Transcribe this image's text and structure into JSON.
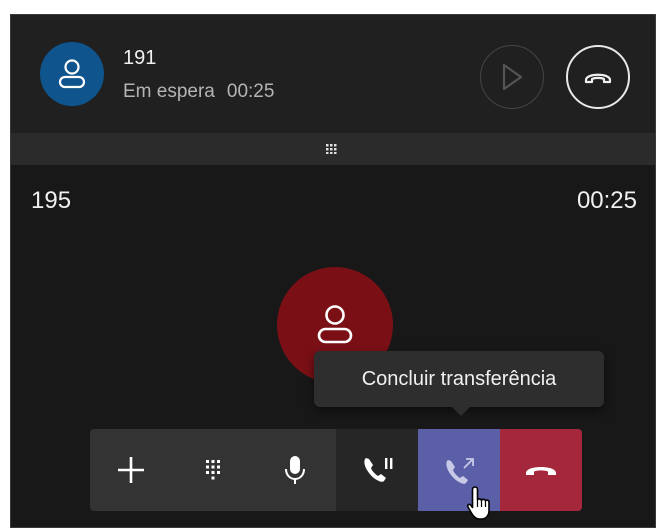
{
  "held_call": {
    "number": "191",
    "status": "Em espera",
    "timer": "00:25",
    "avatar_icon": "person-icon",
    "resume_icon": "play-icon",
    "hangup_icon": "hang-up-icon"
  },
  "divider": {
    "icon": "grip-dots-icon"
  },
  "active_call": {
    "number": "195",
    "timer": "00:25",
    "avatar_icon": "person-icon"
  },
  "tooltip": {
    "text": "Concluir transferência"
  },
  "controls": [
    {
      "name": "add",
      "icon": "plus-icon"
    },
    {
      "name": "dialpad",
      "icon": "dialpad-icon"
    },
    {
      "name": "mute",
      "icon": "microphone-icon"
    },
    {
      "name": "hold",
      "icon": "phone-hold-icon"
    },
    {
      "name": "transfer",
      "icon": "phone-transfer-icon"
    },
    {
      "name": "end",
      "icon": "hang-up-icon"
    }
  ],
  "colors": {
    "held_avatar": "#0f548c",
    "active_avatar": "#7a1016",
    "transfer_button": "#5b5fa7",
    "end_button": "#a4273b"
  }
}
